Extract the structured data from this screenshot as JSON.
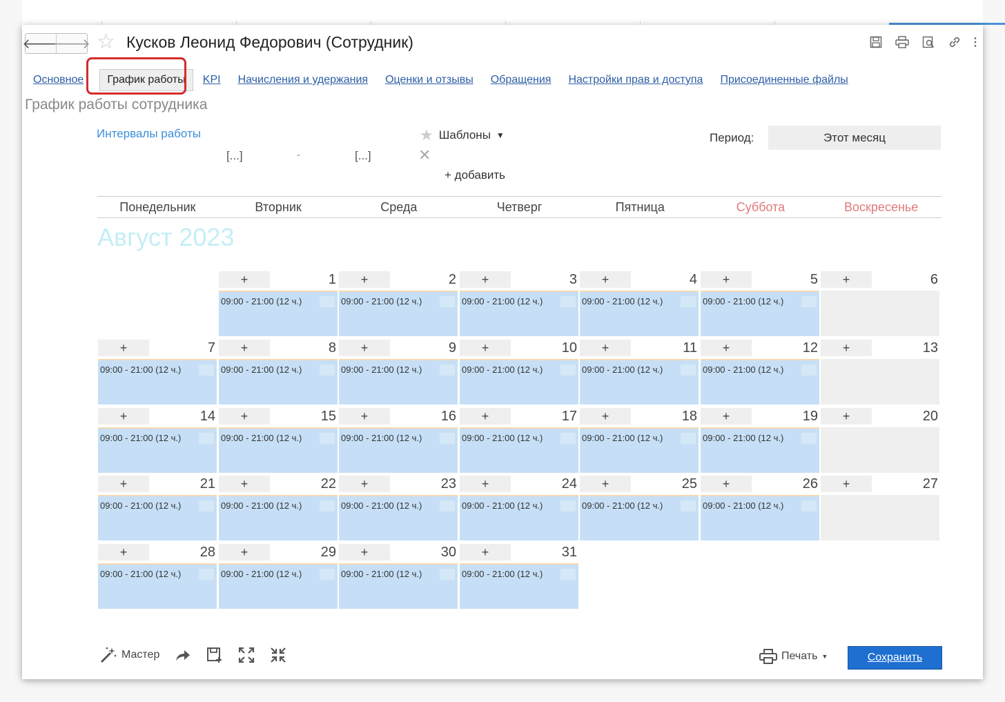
{
  "window": {
    "title": "Кусков Леонид Федорович (Сотрудник)"
  },
  "tabs": [
    {
      "label": "Основное"
    },
    {
      "label": "График работы",
      "active": true
    },
    {
      "label": "KPI"
    },
    {
      "label": "Начисления и удержания"
    },
    {
      "label": "Оценки и отзывы"
    },
    {
      "label": "Обращения"
    },
    {
      "label": "Настройки прав и доступа"
    },
    {
      "label": "Присоединенные файлы"
    }
  ],
  "section_title": "График работы сотрудника",
  "intervals": {
    "label": "Интервалы работы",
    "from": "[...]",
    "dash": "-",
    "to": "[...]"
  },
  "templates": {
    "label": "Шаблоны"
  },
  "add_label": "+ добавить",
  "period": {
    "label": "Период:",
    "value": "Этот месяц"
  },
  "weekdays": [
    "Понедельник",
    "Вторник",
    "Среда",
    "Четверг",
    "Пятница",
    "Суббота",
    "Воскресенье"
  ],
  "month": "Август 2023",
  "day_plus": "+",
  "shift_text": "09:00 - 21:00 (12 ч.)",
  "days": [
    {
      "n": "1",
      "work": true
    },
    {
      "n": "2",
      "work": true
    },
    {
      "n": "3",
      "work": true
    },
    {
      "n": "4",
      "work": true
    },
    {
      "n": "5",
      "work": true
    },
    {
      "n": "6",
      "work": false
    },
    {
      "n": "7",
      "work": true
    },
    {
      "n": "8",
      "work": true
    },
    {
      "n": "9",
      "work": true
    },
    {
      "n": "10",
      "work": true
    },
    {
      "n": "11",
      "work": true
    },
    {
      "n": "12",
      "work": true
    },
    {
      "n": "13",
      "work": false
    },
    {
      "n": "14",
      "work": true
    },
    {
      "n": "15",
      "work": true
    },
    {
      "n": "16",
      "work": true
    },
    {
      "n": "17",
      "work": true
    },
    {
      "n": "18",
      "work": true
    },
    {
      "n": "19",
      "work": true
    },
    {
      "n": "20",
      "work": false
    },
    {
      "n": "21",
      "work": true
    },
    {
      "n": "22",
      "work": true
    },
    {
      "n": "23",
      "work": true
    },
    {
      "n": "24",
      "work": true
    },
    {
      "n": "25",
      "work": true
    },
    {
      "n": "26",
      "work": true
    },
    {
      "n": "27",
      "work": false
    },
    {
      "n": "28",
      "work": true
    },
    {
      "n": "29",
      "work": true
    },
    {
      "n": "30",
      "work": true
    },
    {
      "n": "31",
      "work": true
    }
  ],
  "first_weekday_offset": 1,
  "footer": {
    "master_label": "Мастер",
    "print_label": "Печать",
    "save_label": "Сохранить"
  },
  "colors": {
    "accent": "#1e6fd0",
    "link": "#2d5ea5",
    "work_cell": "#c6dff6",
    "weekend_text": "#e07b7b",
    "highlight": "#d42b2b"
  }
}
